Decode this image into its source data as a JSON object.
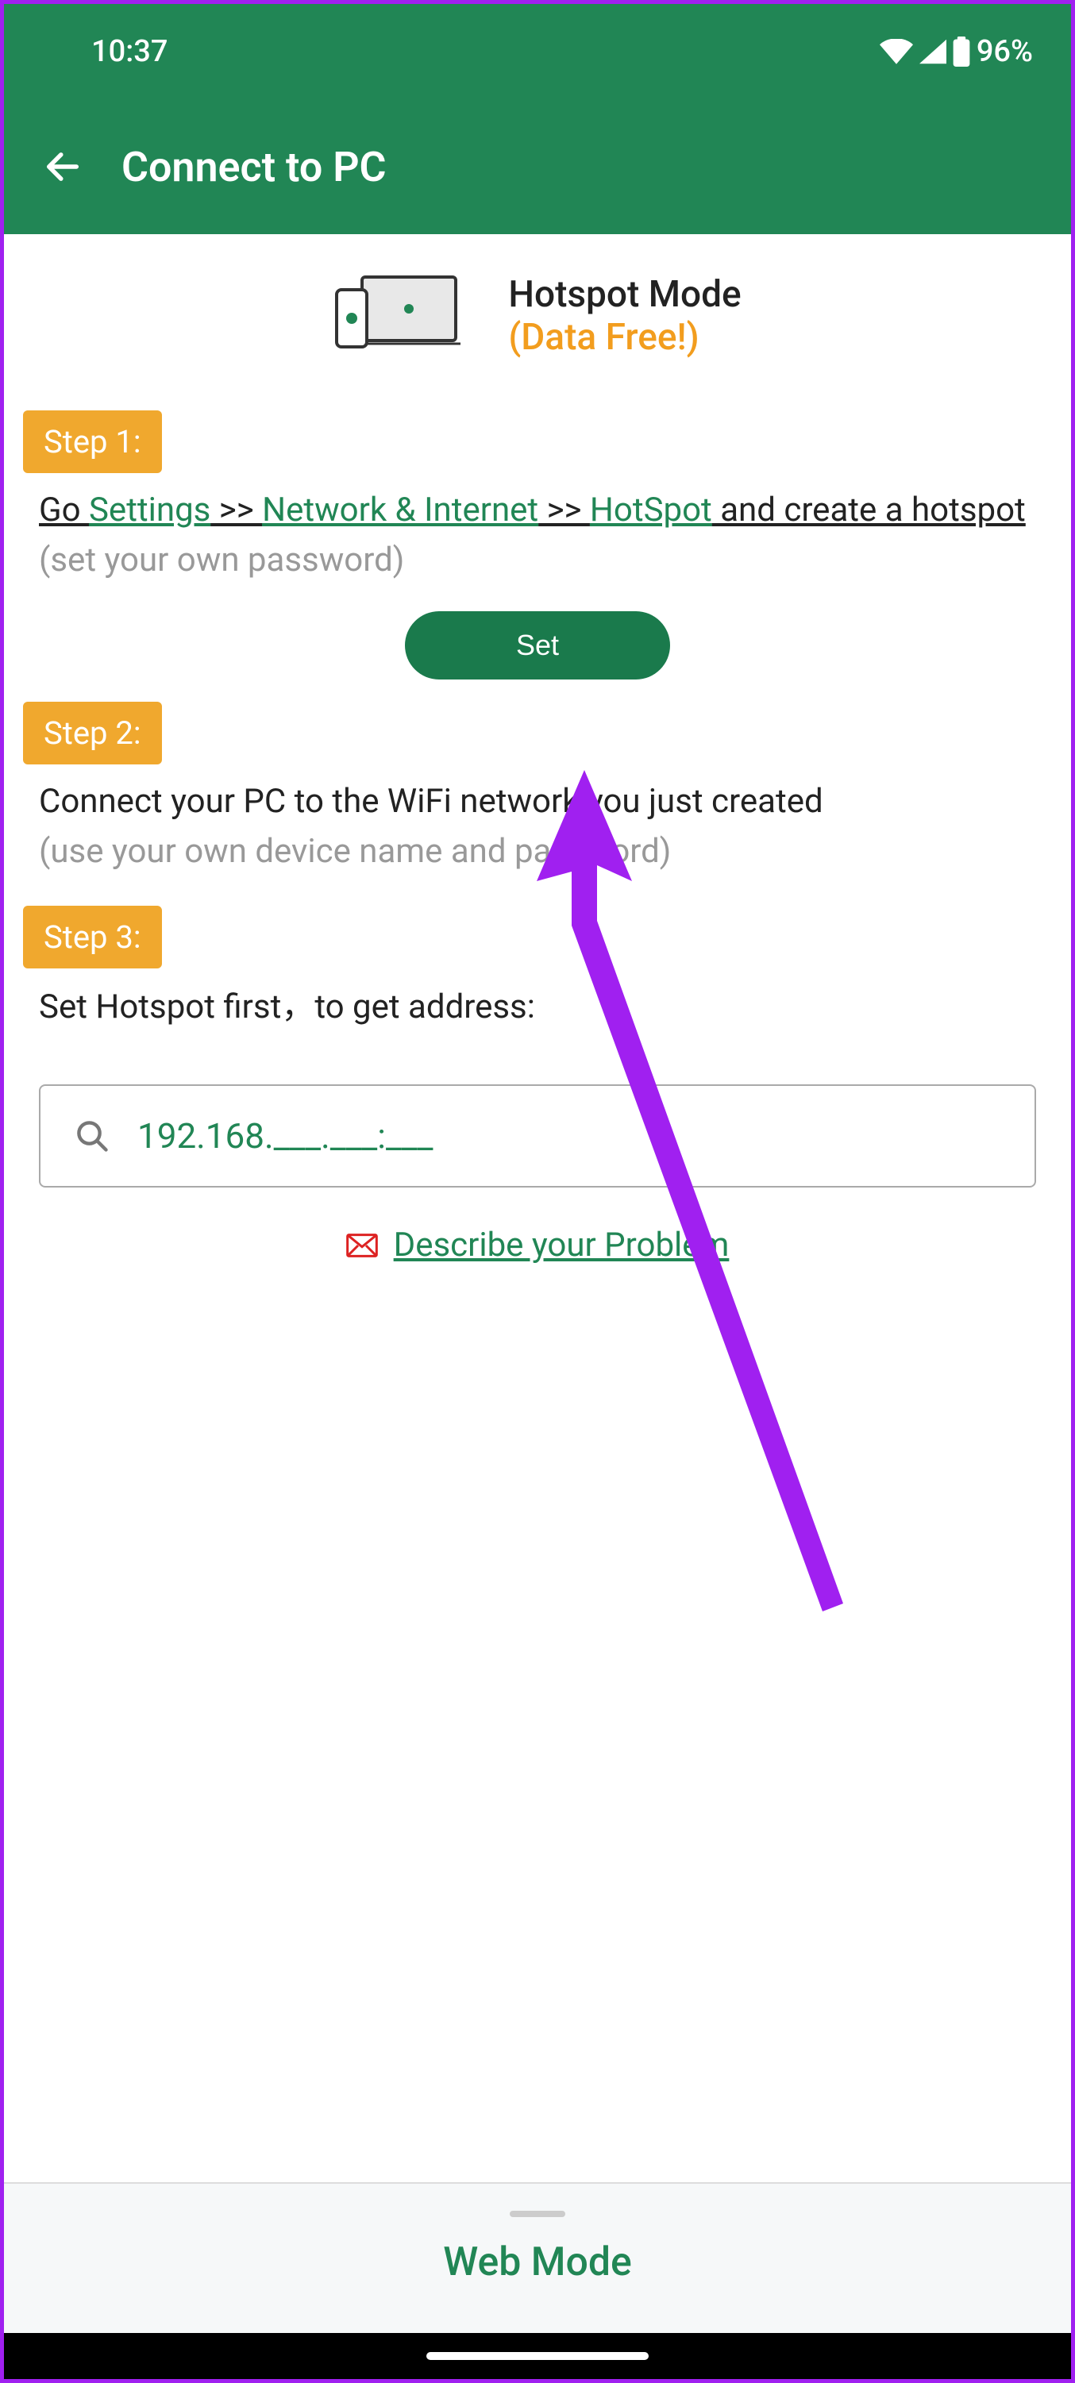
{
  "status": {
    "time": "10:37",
    "battery": "96%"
  },
  "appbar": {
    "title": "Connect to PC"
  },
  "hotspot": {
    "title": "Hotspot Mode",
    "subtitle": "(Data Free!)"
  },
  "step1": {
    "badge": "Step 1:",
    "text_go": "Go ",
    "link_settings": "Settings",
    "sep": " >> ",
    "link_network": "Network & Internet",
    "link_hotspot": "HotSpot",
    "text_tail": " and create a hotspot",
    "hint": "(set your own password)",
    "button": "Set"
  },
  "step2": {
    "badge": "Step 2:",
    "text": "Connect your PC to the WiFi network you just created",
    "hint": "(use your own device name and password)"
  },
  "step3": {
    "badge": "Step 3:",
    "text": "Set Hotspot first，to get address:"
  },
  "address": {
    "value": "192.168.___.___:___"
  },
  "describe": {
    "link": "Describe your Problem"
  },
  "webmode": {
    "label": "Web Mode"
  }
}
